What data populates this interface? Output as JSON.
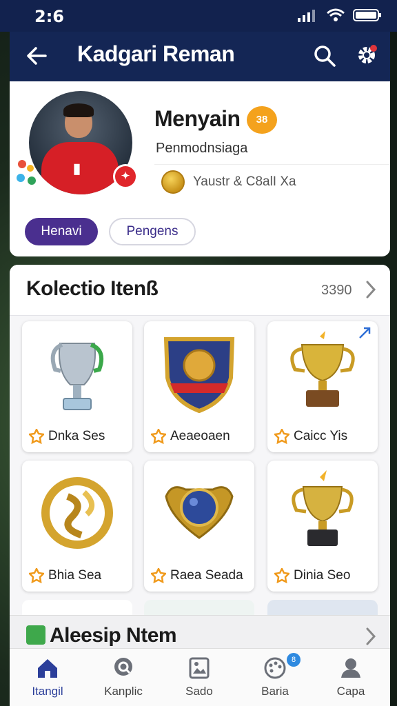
{
  "status": {
    "time": "2:6"
  },
  "header": {
    "title": "Kadgari Reman"
  },
  "profile": {
    "name": "Menyain",
    "level": "38",
    "subtitle": "Penmodnsiaga",
    "stat": "Yaustr & C8alI Xa",
    "buttons": {
      "primary": "Henavi",
      "secondary": "Pengens"
    }
  },
  "collection": {
    "title": "Kolectio Itenß",
    "count": "3390",
    "items": [
      {
        "label": "Dnka Ses",
        "icon": "silver-green-trophy"
      },
      {
        "label": "Aeaeoaen",
        "icon": "shield-crest"
      },
      {
        "label": "Caicc Yis",
        "icon": "gold-cup-trophy"
      },
      {
        "label": "Bhia Sea",
        "icon": "gold-ring-emblem"
      },
      {
        "label": "Raea Seada",
        "icon": "blue-gem-ring"
      },
      {
        "label": "Dinia Seo",
        "icon": "gold-cup-trophy-dark"
      }
    ],
    "more_title": "Aleesip Ntem"
  },
  "nav": [
    {
      "label": "Itangil",
      "icon": "home-icon"
    },
    {
      "label": "Kanplic",
      "icon": "search-globe-icon"
    },
    {
      "label": "Sado",
      "icon": "image-icon"
    },
    {
      "label": "Baria",
      "icon": "palette-icon",
      "badge": "8"
    },
    {
      "label": "Capa",
      "icon": "person-icon"
    }
  ],
  "colors": {
    "primary": "#142655",
    "accent": "#4a2f8f",
    "level": "#f4a21d",
    "gold": "#d9a72a"
  }
}
